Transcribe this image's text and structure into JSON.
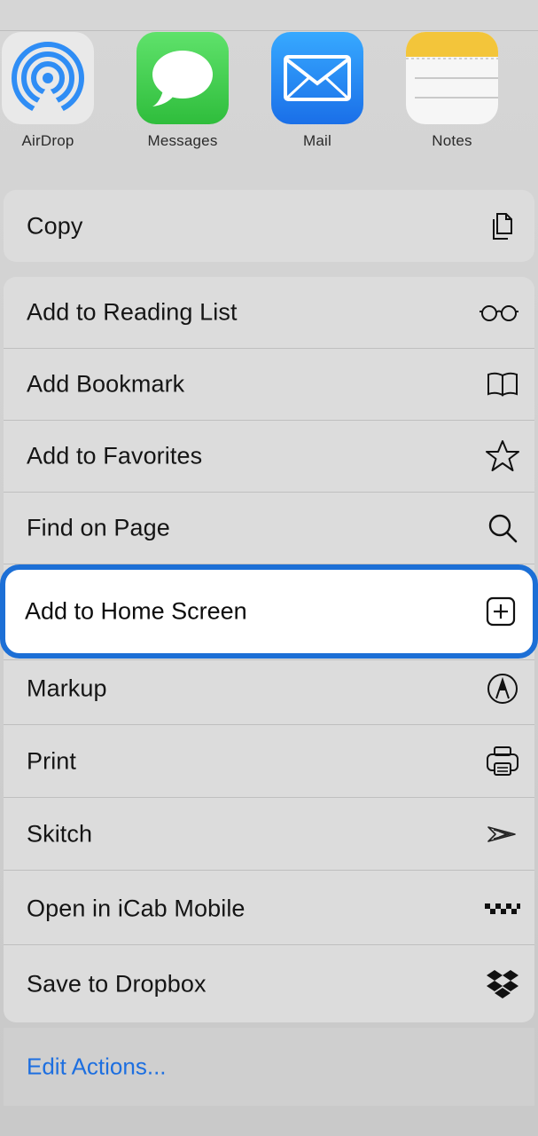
{
  "apps": [
    {
      "label": "AirDrop",
      "icon": "airdrop-icon"
    },
    {
      "label": "Messages",
      "icon": "messages-icon"
    },
    {
      "label": "Mail",
      "icon": "mail-icon"
    },
    {
      "label": "Notes",
      "icon": "notes-icon"
    }
  ],
  "copy": {
    "label": "Copy",
    "icon": "copy-icon"
  },
  "actions": [
    {
      "label": "Add to Reading List",
      "icon": "glasses-icon"
    },
    {
      "label": "Add Bookmark",
      "icon": "book-icon"
    },
    {
      "label": "Add to Favorites",
      "icon": "star-icon"
    },
    {
      "label": "Find on Page",
      "icon": "search-icon"
    },
    {
      "label": "Add to Home Screen",
      "icon": "add-square-icon",
      "highlighted": true
    },
    {
      "label": "Markup",
      "icon": "markup-icon"
    },
    {
      "label": "Print",
      "icon": "printer-icon"
    },
    {
      "label": "Skitch",
      "icon": "skitch-icon"
    },
    {
      "label": "Open in iCab Mobile",
      "icon": "icab-icon"
    },
    {
      "label": "Save to Dropbox",
      "icon": "dropbox-icon"
    }
  ],
  "edit_actions": {
    "label": "Edit Actions..."
  },
  "colors": {
    "accent": "#1c6fd6",
    "link": "#1d6fe0"
  }
}
